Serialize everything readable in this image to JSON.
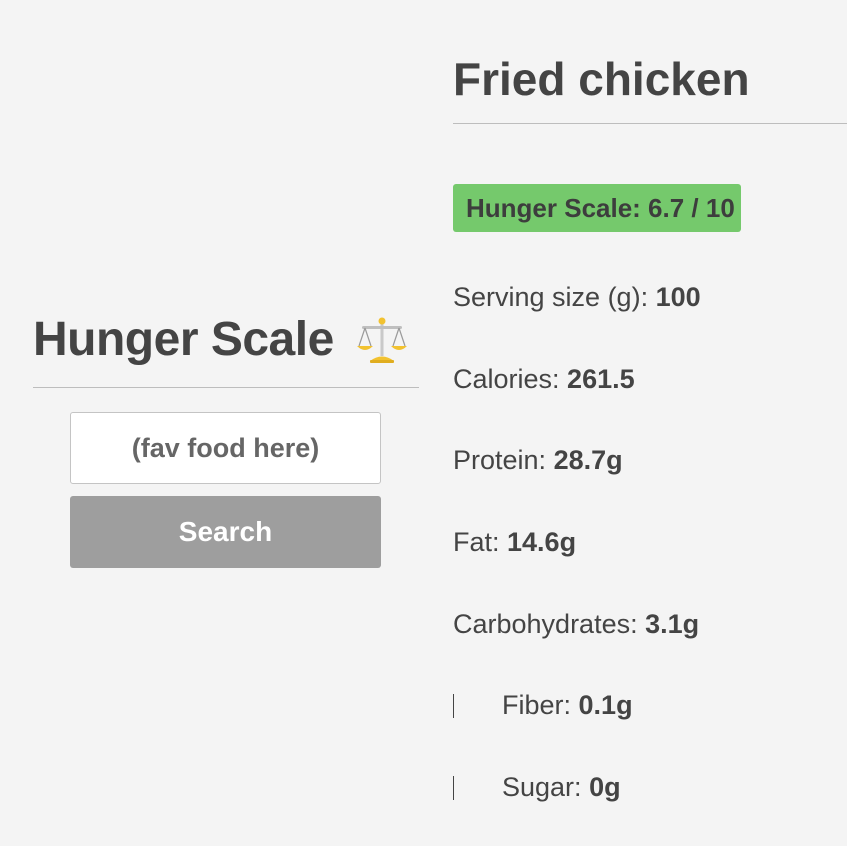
{
  "left": {
    "app_title": "Hunger Scale",
    "app_icon": "balance-scale-icon",
    "search": {
      "placeholder": "(fav food here)",
      "value": ""
    },
    "search_button_label": "Search"
  },
  "food": {
    "name": "Fried chicken",
    "hunger_scale": {
      "label": "Hunger Scale: 6.7 / 10",
      "score": 6.7,
      "max": 10,
      "bar_color": "#75c96c"
    },
    "nutrients": [
      {
        "label": "Serving size (g): ",
        "value": "100",
        "sub": false
      },
      {
        "label": "Calories: ",
        "value": "261.5",
        "sub": false
      },
      {
        "label": "Protein: ",
        "value": "28.7g",
        "sub": false
      },
      {
        "label": "Fat: ",
        "value": "14.6g",
        "sub": false
      },
      {
        "label": "Carbohydrates: ",
        "value": "3.1g",
        "sub": false
      },
      {
        "label": "Fiber: ",
        "value": "0.1g",
        "sub": true
      },
      {
        "label": "Sugar: ",
        "value": "0g",
        "sub": true
      }
    ]
  },
  "colors": {
    "background": "#f4f4f4",
    "text": "#444444",
    "button": "#9e9e9e",
    "hunger_bar": "#75c96c"
  }
}
